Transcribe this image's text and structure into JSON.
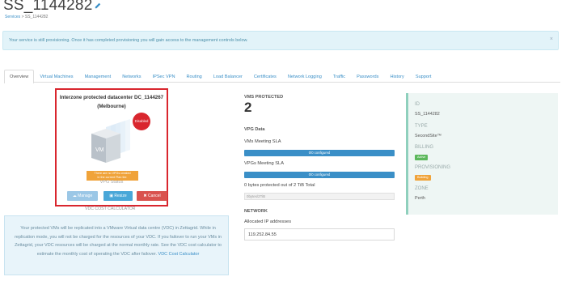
{
  "header": {
    "title": "SS_1144282",
    "breadcrumb": {
      "link": "Services",
      "separator": ">",
      "current": "SS_1144282"
    }
  },
  "alert": {
    "text": "Your service is still provisioning. Once it has completed provisioning you will gain access to the management controls below.",
    "close": "×"
  },
  "tabs": [
    {
      "label": "Overview"
    },
    {
      "label": "Virtual Machines"
    },
    {
      "label": "Management"
    },
    {
      "label": "Networks"
    },
    {
      "label": "IPSec VPN"
    },
    {
      "label": "Routing"
    },
    {
      "label": "Load Balancer"
    },
    {
      "label": "Certificates"
    },
    {
      "label": "Network Logging"
    },
    {
      "label": "Traffic"
    },
    {
      "label": "Passwords"
    },
    {
      "label": "History"
    },
    {
      "label": "Support"
    }
  ],
  "datacenter": {
    "title_line1": "Interzone protected datacenter DC_1144267",
    "title_line2": "(Melbourne)",
    "disabled_badge": "Disabled",
    "warning_line1": "There are no VPGs created",
    "warning_line2": "in the current Plan tier.",
    "vpg_status": "VPG Status",
    "buttons": {
      "manage": "Manage",
      "resize": "Resize",
      "cancel": "Cancel"
    },
    "vm_label": "VM"
  },
  "vdc_calc_label": "VDC COST CALCULATOR",
  "info": {
    "text": "Your protected VMs will be replicated into a VMware Virtual data centre (VDC) in Zettagrid. While in replication mode, you will not be charged for the resources of your VDC. If you failover to run your VMs in Zettagrid, your VDC resources will be charged at the normal monthly rate. See the VDC cost calculator to estimate the monthly cost of operating the VDC after failover.",
    "link": "VDC Cost Calculator"
  },
  "stats": {
    "vms_protected_label": "VMS PROTECTED",
    "vms_protected_value": "2",
    "vpg_data_label": "VPG Data",
    "vms_sla_label": "VMs Meeting SLA",
    "vms_sla_bar": "0/0 configured",
    "vpgs_sla_label": "VPGs Meeting SLA",
    "vpgs_sla_bar": "0/0 configured",
    "bytes_text": "0 bytes protected out of 2 TiB Total",
    "bytes_bar": "0bytes/2TiB",
    "network_label": "NETWORK",
    "allocated_ip_label": "Allocated IP addresses",
    "ip_value": "119.252.84.55"
  },
  "side_panel": {
    "id_key": "ID",
    "id_val": "SS_1144282",
    "type_key": "TYPE",
    "type_val": "SecondSite™",
    "billing_key": "BILLING",
    "billing_badge": "Active",
    "provisioning_key": "PROVISIONING",
    "provisioning_badge": "Building",
    "zone_key": "ZONE",
    "zone_val": "Perth"
  },
  "colors": {
    "accent": "#3a8fc7",
    "danger": "#d9262e",
    "warning": "#f0a33a",
    "success": "#5cb85c"
  }
}
